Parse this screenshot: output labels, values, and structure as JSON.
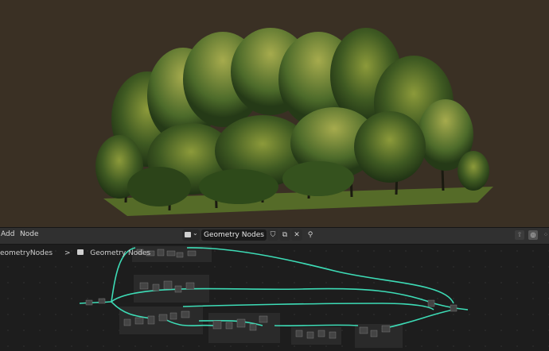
{
  "menu": {
    "add": "Add",
    "node": "Node"
  },
  "node_tree": {
    "name": "Geometry Nodes"
  },
  "breadcrumb": {
    "root": "eometryNodes",
    "separator": ">",
    "current": "Geometry Nodes"
  },
  "colors": {
    "geometry_link": "#3ddcb6",
    "viewport_bg": "#3a3024",
    "editor_bg": "#1d1d1d"
  },
  "icons": {
    "tree_type": "node-tree-icon",
    "shield": "fake-user-shield-icon",
    "copy": "duplicate-icon",
    "close": "close-icon",
    "pin": "pin-icon",
    "up": "parent-node-tree-icon",
    "overlay": "overlay-icon"
  }
}
